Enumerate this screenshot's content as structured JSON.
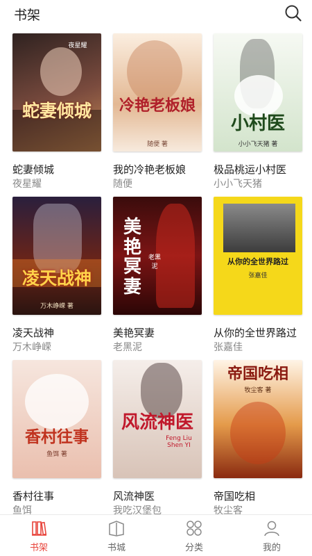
{
  "header": {
    "title": "书架",
    "search_icon": "search-icon"
  },
  "books": [
    {
      "title": "蛇妻倾城",
      "author": "夜星耀",
      "cover_text": "蛇妻倾城",
      "cover_author": "夜星耀",
      "colors": [
        "#3b2a26",
        "#7a4b3e",
        "#e0a55a"
      ],
      "text_color": "#ffe7a0"
    },
    {
      "title": "我的冷艳老板娘",
      "author": "随便",
      "cover_text": "冷艳老板娘",
      "cover_author": "随便 著",
      "colors": [
        "#f4e2cf",
        "#d8a77e",
        "#ffffff"
      ],
      "text_color": "#b0202a"
    },
    {
      "title": "极品桃运小村医",
      "author": "小小飞天猪",
      "cover_text": "小村医",
      "cover_author": "小小飞天猪 著",
      "colors": [
        "#eef3ea",
        "#c7dcc0",
        "#ffffff"
      ],
      "text_color": "#1f4a1c"
    },
    {
      "title": "凌天战神",
      "author": "万木峥嵘",
      "cover_text": "凌天战神",
      "cover_author": "万木峥嵘 著",
      "colors": [
        "#2a1f3d",
        "#8b2a1a",
        "#ff8a2a"
      ],
      "text_color": "#ffd34a"
    },
    {
      "title": "美艳冥妻",
      "author": "老黑泥",
      "cover_text": "美艳冥妻",
      "cover_author": "老黑泥",
      "colors": [
        "#2b0b0b",
        "#7c1414",
        "#c23a2a"
      ],
      "text_color": "#ffffff"
    },
    {
      "title": "从你的全世界路过",
      "author": "张嘉佳",
      "cover_text": "从你的全世界路过",
      "cover_author": "张嘉佳",
      "colors": [
        "#f5d81a",
        "#5a5a5a",
        "#f5d81a"
      ],
      "text_color": "#222222"
    },
    {
      "title": "香村往事",
      "author": "鱼饵",
      "cover_text": "香村往事",
      "cover_author": "鱼饵 著",
      "colors": [
        "#f3ddd3",
        "#e9b9a7",
        "#ffffff"
      ],
      "text_color": "#c0331f"
    },
    {
      "title": "风流神医",
      "author": "我吃汉堡包",
      "cover_text": "风流神医",
      "cover_author": "Feng Liu Shen YI",
      "colors": [
        "#f2e9e4",
        "#d8c3b7",
        "#ffffff"
      ],
      "text_color": "#c0182b"
    },
    {
      "title": "帝国吃相",
      "author": "牧尘客",
      "cover_text": "帝国吃相",
      "cover_author": "牧尘客 著",
      "colors": [
        "#fff4e6",
        "#d36a2a",
        "#7a2a10"
      ],
      "text_color": "#8a1a10"
    }
  ],
  "tabs": [
    {
      "label": "书架",
      "icon": "bookshelf-icon",
      "active": true
    },
    {
      "label": "书城",
      "icon": "bookstore-icon",
      "active": false
    },
    {
      "label": "分类",
      "icon": "category-grid-icon",
      "active": false
    },
    {
      "label": "我的",
      "icon": "profile-icon",
      "active": false
    }
  ],
  "accent_color": "#e8453c"
}
